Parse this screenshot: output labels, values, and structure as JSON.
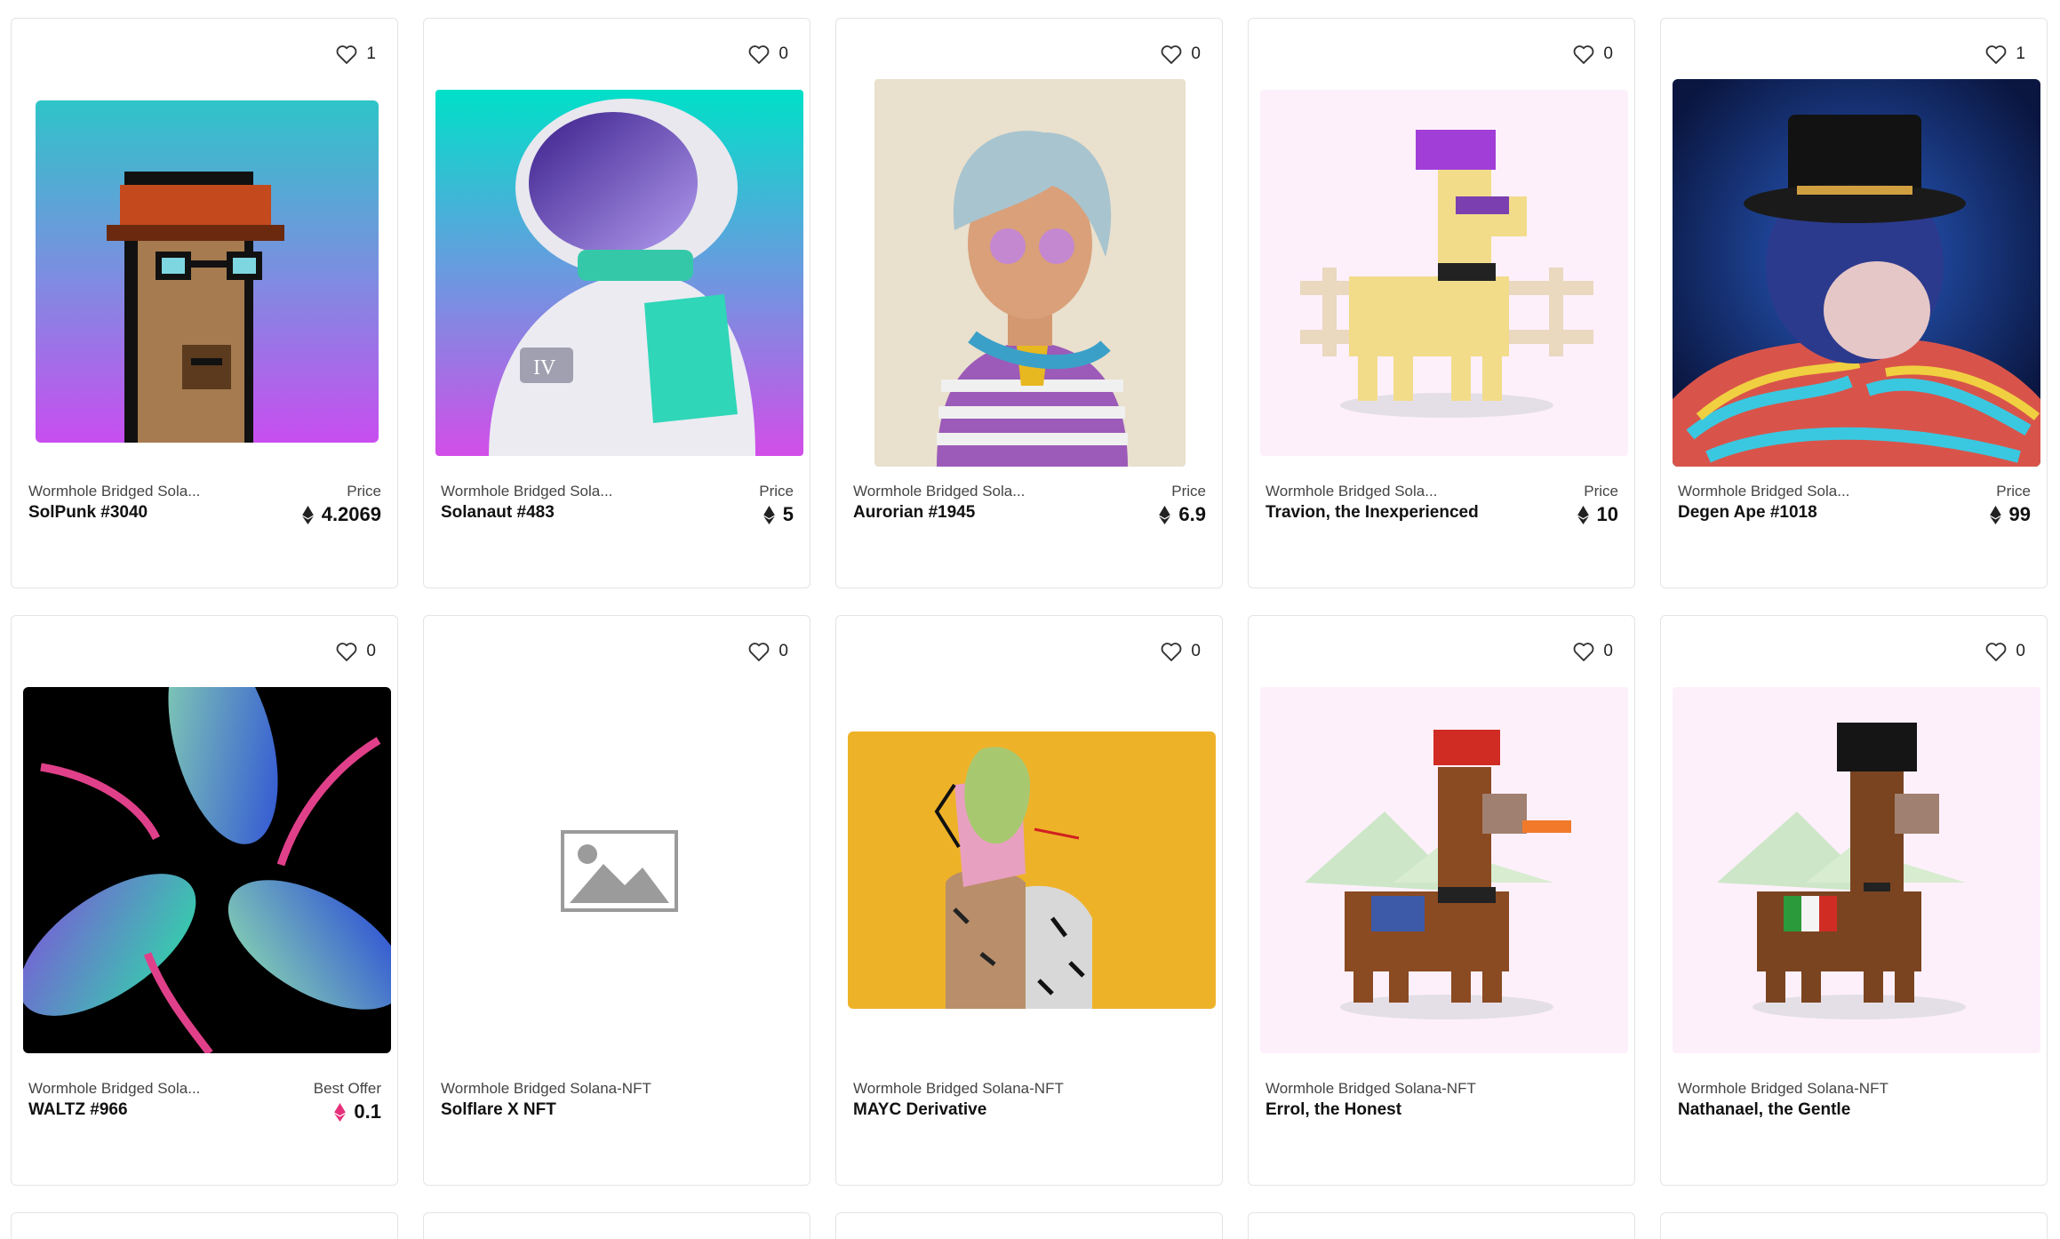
{
  "cards": [
    {
      "likes": "1",
      "collection": "Wormhole Bridged Sola...",
      "name": "SolPunk #3040",
      "price_label": "Price",
      "price": "4.2069",
      "currency_color": "#222222"
    },
    {
      "likes": "0",
      "collection": "Wormhole Bridged Sola...",
      "name": "Solanaut #483",
      "price_label": "Price",
      "price": "5",
      "currency_color": "#222222"
    },
    {
      "likes": "0",
      "collection": "Wormhole Bridged Sola...",
      "name": "Aurorian #1945",
      "price_label": "Price",
      "price": "6.9",
      "currency_color": "#222222"
    },
    {
      "likes": "0",
      "collection": "Wormhole Bridged Sola...",
      "name": "Travion, the Inexperienced",
      "price_label": "Price",
      "price": "10",
      "currency_color": "#222222"
    },
    {
      "likes": "1",
      "collection": "Wormhole Bridged Sola...",
      "name": "Degen Ape #1018",
      "price_label": "Price",
      "price": "99",
      "currency_color": "#222222"
    },
    {
      "likes": "0",
      "collection": "Wormhole Bridged Sola...",
      "name": "WALTZ #966",
      "price_label": "Best Offer",
      "price": "0.1",
      "currency_color": "#e6307a"
    },
    {
      "likes": "0",
      "collection": "Wormhole Bridged Solana-NFT",
      "name": "Solflare X NFT"
    },
    {
      "likes": "0",
      "collection": "Wormhole Bridged Solana-NFT",
      "name": "MAYC Derivative"
    },
    {
      "likes": "0",
      "collection": "Wormhole Bridged Solana-NFT",
      "name": "Errol, the Honest"
    },
    {
      "likes": "0",
      "collection": "Wormhole Bridged Solana-NFT",
      "name": "Nathanael, the Gentle"
    }
  ],
  "icons": {
    "like": "heart-icon",
    "currency": "ethereum-icon",
    "placeholder": "image-placeholder-icon"
  }
}
